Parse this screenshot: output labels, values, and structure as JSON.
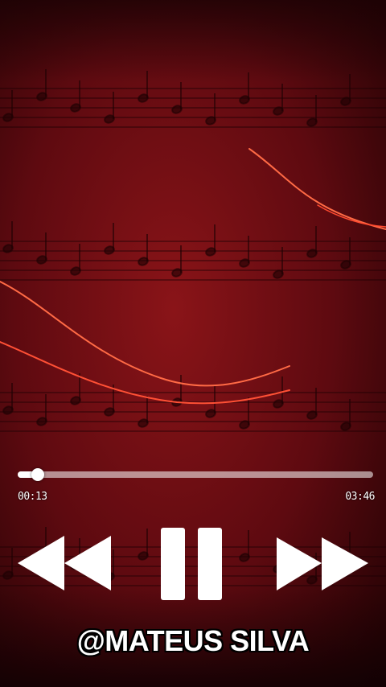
{
  "player": {
    "elapsed": "00:13",
    "total": "03:46",
    "progress_fraction": 0.0575
  },
  "controls": {
    "rewind_icon": "rewind-icon",
    "pause_icon": "pause-icon",
    "forward_icon": "fast-forward-icon"
  },
  "watermark": "@MATEUS SILVA",
  "colors": {
    "background": "#5a0a10",
    "accent_line": "#ff5a3a",
    "controls": "#ffffff"
  }
}
